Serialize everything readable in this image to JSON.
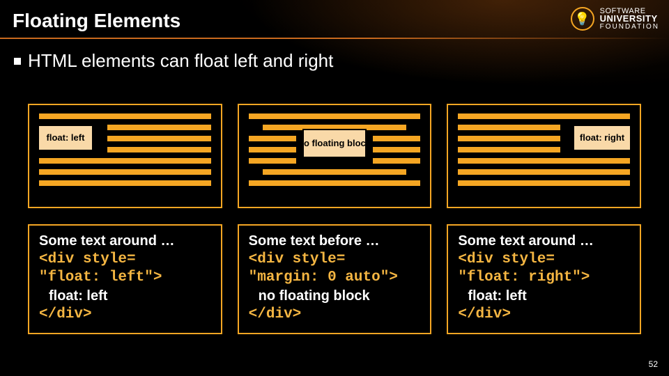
{
  "title": "Floating Elements",
  "bullet": "HTML elements can float left and right",
  "logo": {
    "line1": "SOFTWARE",
    "line2": "UNIVERSITY",
    "line3": "FOUNDATION"
  },
  "panels": {
    "left_label": "float: left",
    "center_label": "no floating block",
    "right_label": "float: right"
  },
  "code": {
    "left": {
      "pre": "Some text around …",
      "open": "<div style=",
      "attr": "\"float: left\">",
      "inner": "float: left",
      "close": "</div>"
    },
    "center": {
      "pre": "Some text before …",
      "open": "<div style=",
      "attr": "\"margin: 0 auto\">",
      "inner": "no floating block",
      "close": "</div>"
    },
    "right": {
      "pre": "Some text around …",
      "open": "<div style=",
      "attr": "\"float: right\">",
      "inner": "float: left",
      "close": "</div>"
    }
  },
  "page_number": "52"
}
